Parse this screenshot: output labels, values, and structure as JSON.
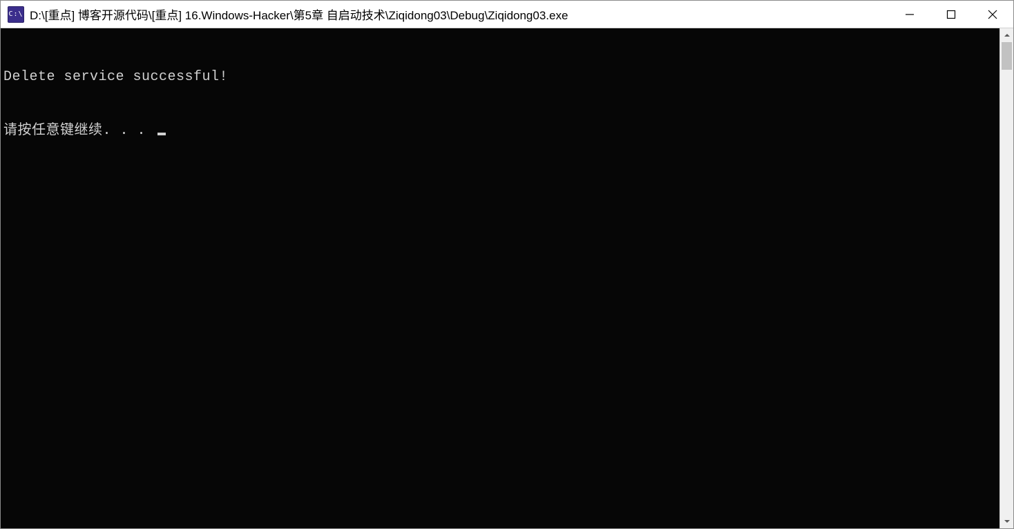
{
  "window": {
    "icon_label": "C:\\",
    "title": "D:\\[重点] 博客开源代码\\[重点] 16.Windows-Hacker\\第5章 自启动技术\\Ziqidong03\\Debug\\Ziqidong03.exe"
  },
  "console": {
    "lines": [
      "Delete service successful!",
      "请按任意键继续. . . "
    ]
  },
  "controls": {
    "minimize": "Minimize",
    "maximize": "Maximize",
    "close": "Close"
  }
}
